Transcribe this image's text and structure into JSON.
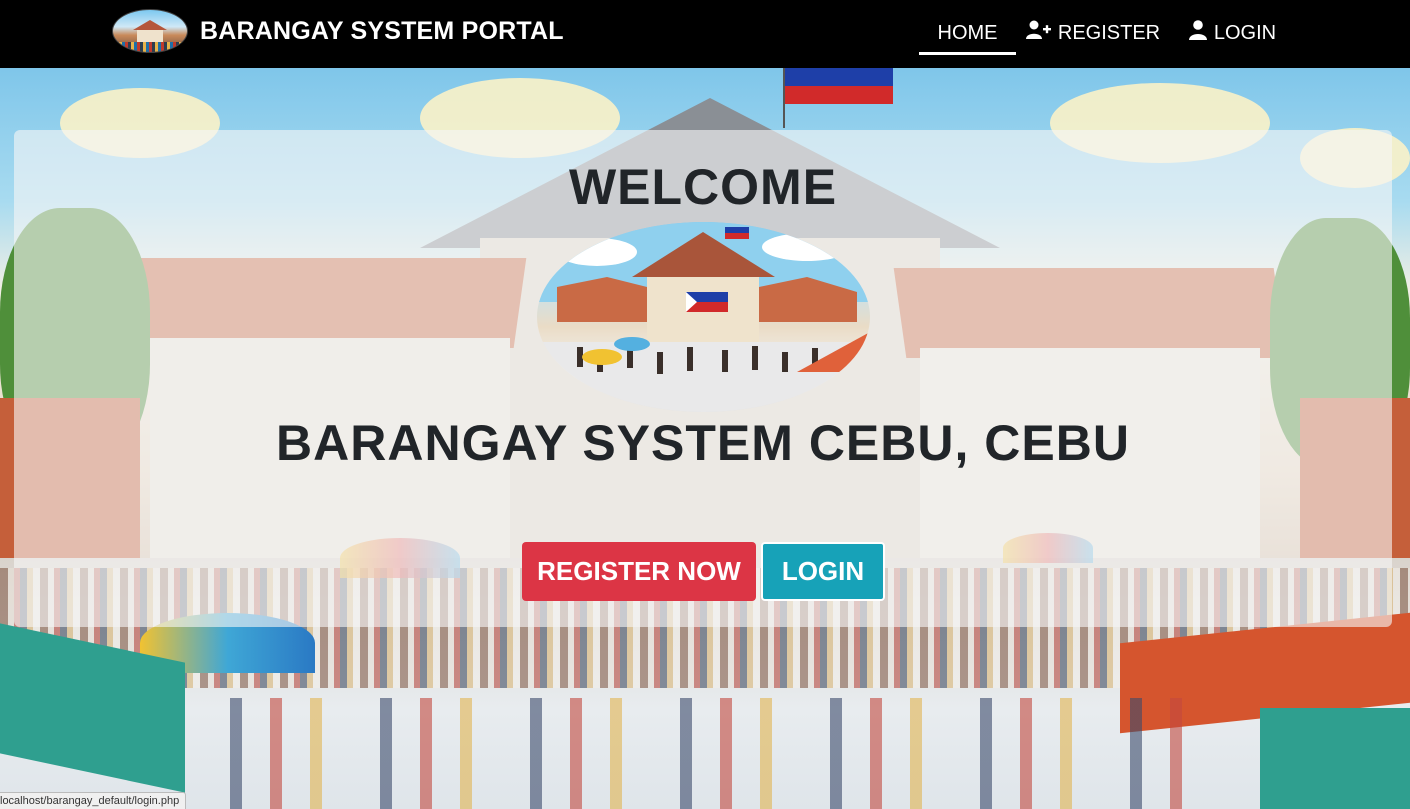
{
  "navbar": {
    "brand": "BARANGAY SYSTEM PORTAL",
    "items": [
      {
        "label": "HOME",
        "icon": "",
        "active": true
      },
      {
        "label": "REGISTER",
        "icon": "user-plus-icon",
        "active": false
      },
      {
        "label": "LOGIN",
        "icon": "user-icon",
        "active": false
      }
    ]
  },
  "hero": {
    "welcome": "WELCOME",
    "subtitle": "BARANGAY SYSTEM CEBU, CEBU",
    "register_button": "REGISTER NOW",
    "login_button": "LOGIN"
  },
  "status": {
    "url": "localhost/barangay_default/login.php"
  },
  "colors": {
    "navbar_bg": "#000000",
    "register_btn": "#dc3545",
    "login_btn": "#17a2b8",
    "text_dark": "#212529"
  }
}
